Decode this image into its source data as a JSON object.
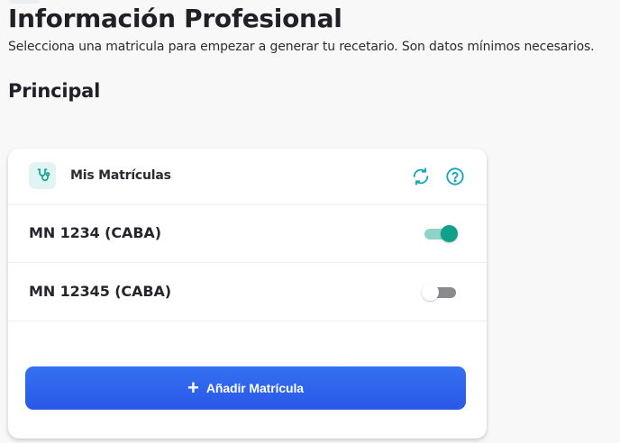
{
  "header": {
    "title": "Información Profesional",
    "subtitle": "Selecciona una matricula para empezar a generar tu recetario. Son datos mínimos necesarios."
  },
  "section": {
    "title": "Principal"
  },
  "card": {
    "title": "Mis Matrículas",
    "icons": {
      "leading": "stethoscope-icon",
      "refresh": "refresh-icon",
      "help": "help-icon"
    },
    "rows": [
      {
        "label": "MN 1234 (CABA)",
        "enabled": true
      },
      {
        "label": "MN 12345 (CABA)",
        "enabled": false
      }
    ],
    "add_button": {
      "icon": "+",
      "label": "Añadir Matrícula"
    }
  },
  "colors": {
    "accent_teal": "#12a08b",
    "accent_teal_light": "#8fd3c8",
    "button_blue": "#2f63ec",
    "background": "#f8f8f8"
  }
}
